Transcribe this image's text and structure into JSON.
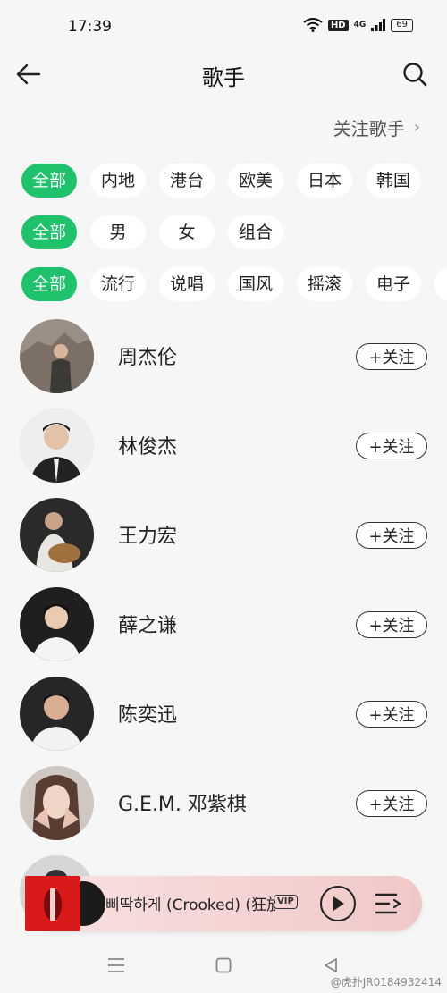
{
  "status_bar": {
    "time": "17:39",
    "hd": "HD",
    "network": "4G",
    "battery": "69"
  },
  "header": {
    "title": "歌手"
  },
  "follow_link": {
    "label": "关注歌手"
  },
  "filters": {
    "region": [
      "全部",
      "内地",
      "港台",
      "欧美",
      "日本",
      "韩国"
    ],
    "gender": [
      "全部",
      "男",
      "女",
      "组合"
    ],
    "genre": [
      "全部",
      "流行",
      "说唱",
      "国风",
      "摇滚",
      "电子"
    ]
  },
  "singers": [
    {
      "name": "周杰伦",
      "follow": "+关注"
    },
    {
      "name": "林俊杰",
      "follow": "+关注"
    },
    {
      "name": "王力宏",
      "follow": "+关注"
    },
    {
      "name": "薛之谦",
      "follow": "+关注"
    },
    {
      "name": "陈奕迅",
      "follow": "+关注"
    },
    {
      "name": "G.E.M. 邓紫棋",
      "follow": "+关注"
    }
  ],
  "player": {
    "title": "삐딱하게 (Crooked) (狂放",
    "vip": "VIP"
  },
  "watermark": "@虎扑JR0184932414"
}
